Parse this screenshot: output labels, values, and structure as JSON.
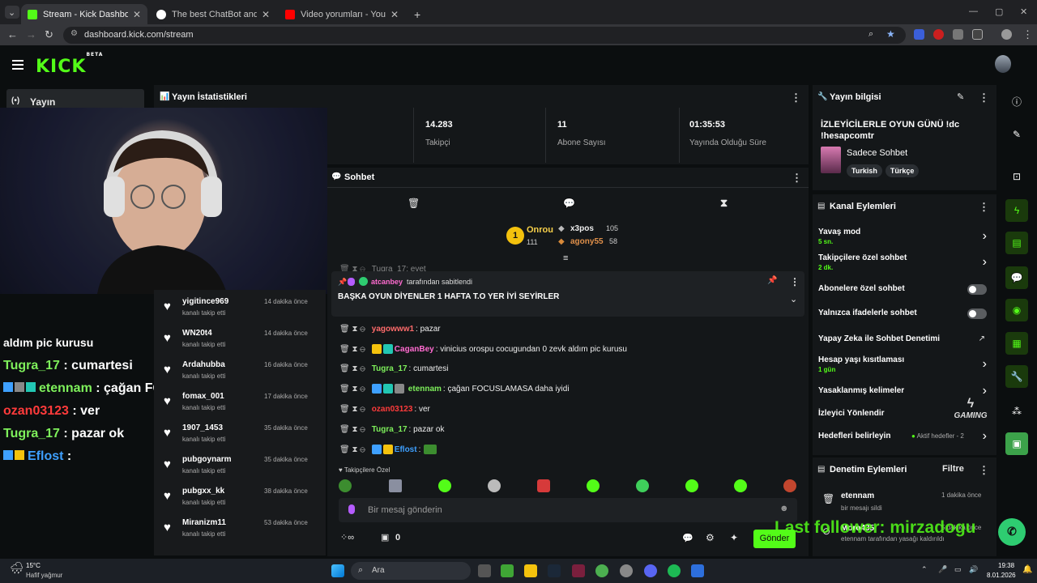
{
  "browser": {
    "tabs": [
      {
        "title": "Stream - Kick Dashboard",
        "color": "#53fc18"
      },
      {
        "title": "The best ChatBot and Widgets",
        "color": "#ffffff"
      },
      {
        "title": "Video yorumları - YouTube Stu",
        "color": "#ff0000"
      }
    ],
    "url": "dashboard.kick.com/stream"
  },
  "kick": {
    "logo": "KICK",
    "beta": "BETA"
  },
  "left_nav": {
    "yayin_label": "Yayın"
  },
  "stats": {
    "title": "Yayın İstatistikleri",
    "items": [
      {
        "value": "14.283",
        "label": "Takipçi"
      },
      {
        "value": "11",
        "label": "Abone Sayısı"
      },
      {
        "value": "01:35:53",
        "label": "Yayında Olduğu Süre"
      }
    ]
  },
  "overlay_chat": [
    {
      "user": "",
      "text": "aldım pic kurusu",
      "color": "#ffffff"
    },
    {
      "user": "Tugra_17",
      "text": " : cumartesi",
      "color": "#7ef05b"
    },
    {
      "user": "etennam",
      "text": " : çağan FOCUSLAMASA daha",
      "color": "#7ef05b"
    },
    {
      "user": "ozan03123",
      "text": " : ver",
      "color": "#ff3b3b"
    },
    {
      "user": "Tugra_17",
      "text": " : pazar ok",
      "color": "#7ef05b"
    },
    {
      "user": "Eflost",
      "text": " :",
      "color": "#3ea0ff"
    }
  ],
  "followers": [
    {
      "name": "yigitince969",
      "sub": "kanalı takip etti",
      "time": "14 dakika önce"
    },
    {
      "name": "WN20t4",
      "sub": "kanalı takip etti",
      "time": "14 dakika önce"
    },
    {
      "name": "Ardahubba",
      "sub": "kanalı takip etti",
      "time": "16 dakika önce"
    },
    {
      "name": "fomax_001",
      "sub": "kanalı takip etti",
      "time": "17 dakika önce"
    },
    {
      "name": "1907_1453",
      "sub": "kanalı takip etti",
      "time": "35 dakika önce"
    },
    {
      "name": "pubgoynarm",
      "sub": "kanalı takip etti",
      "time": "35 dakika önce"
    },
    {
      "name": "pubgxx_kk",
      "sub": "kanalı takip etti",
      "time": "38 dakika önce"
    },
    {
      "name": "Miranizm11",
      "sub": "kanalı takip etti",
      "time": "53 dakika önce"
    }
  ],
  "chat": {
    "title": "Sohbet",
    "leaderboard": [
      {
        "name": "Onrou",
        "score": "111"
      },
      {
        "name": "x3pos",
        "score": "105"
      },
      {
        "name": "agony55",
        "score": "58"
      }
    ],
    "pinned": {
      "by_user": "atcanbey",
      "by_text": "tarafından sabitlendi",
      "message": "BAŞKA OYUN DİYENLER 1 HAFTA T.O YER İYİ SEYİRLER"
    },
    "top_partial": "Tugra_17: evet",
    "messages": [
      {
        "user": "yagowww1",
        "text": ": pazar",
        "color": "#ff6b6b"
      },
      {
        "user": "CaganBey",
        "text": ": vinicius orospu cocugundan 0 zevk aldım pic kurusu",
        "color": "#ff6bd0"
      },
      {
        "user": "Tugra_17",
        "text": ": cumartesi",
        "color": "#7ef05b"
      },
      {
        "user": "etennam",
        "text": ": çağan FOCUSLAMASA daha iyidi",
        "color": "#7ef05b"
      },
      {
        "user": "ozan03123",
        "text": ": ver",
        "color": "#ff3b3b"
      },
      {
        "user": "Tugra_17",
        "text": ": pazar ok",
        "color": "#7ef05b"
      },
      {
        "user": "Eflost",
        "text": ":",
        "color": "#3ea0ff"
      }
    ],
    "followers_only_label": "Takipçilere Özel",
    "input_placeholder": "Bir mesaj gönderin",
    "counter": "0",
    "send": "Gönder"
  },
  "stream_info": {
    "title_panel": "Yayın bilgisi",
    "stream_title": "İZLEYİCİLERLE OYUN GÜNÜ !dc !hesapcomtr",
    "category": "Sadece Sohbet",
    "tags": [
      "Turkish",
      "Türkçe"
    ]
  },
  "channel_actions": {
    "title": "Kanal Eylemleri",
    "rows": [
      {
        "label": "Yavaş mod",
        "sub": "5 sn.",
        "control": "chevron"
      },
      {
        "label": "Takipçilere özel sohbet",
        "sub": "2 dk.",
        "control": "chevron"
      },
      {
        "label": "Abonelere özel sohbet",
        "sub": "",
        "control": "toggle"
      },
      {
        "label": "Yalnızca ifadelerle sohbet",
        "sub": "",
        "control": "toggle"
      },
      {
        "label": "Yapay Zeka ile Sohbet Denetimi",
        "sub": "",
        "control": "external"
      },
      {
        "label": "Hesap yaşı kısıtlaması",
        "sub": "1 gün",
        "control": "chevron"
      },
      {
        "label": "Yasaklanmış kelimeler",
        "sub": "",
        "control": "chevron"
      },
      {
        "label": "İzleyici Yönlendir",
        "sub": "",
        "control": "none"
      },
      {
        "label": "Hedefleri belirleyin",
        "sub": "",
        "control": "chevron"
      }
    ],
    "active_goals": "Aktif hedefler - 2"
  },
  "mod_actions": {
    "title": "Denetim Eylemleri",
    "filter": "Filtre",
    "items": [
      {
        "user": "etennam",
        "desc": "bir mesajı sildi",
        "time": "1 dakika önce"
      },
      {
        "user": "Moro435",
        "desc": "etennam tarafından yasağı kaldırıldı",
        "time": "5 dakika önce"
      }
    ]
  },
  "overlay_last_follower": "Last follower: mirzadogu",
  "watermark": "GAMING",
  "taskbar": {
    "weather_temp": "15°C",
    "weather_desc": "Hafif yağmur",
    "search": "Ara",
    "time": "19:38",
    "date": "8.01.2026"
  },
  "colors": {
    "accent": "#53fc18",
    "panel": "#141719",
    "bg": "#0b0e0f"
  }
}
